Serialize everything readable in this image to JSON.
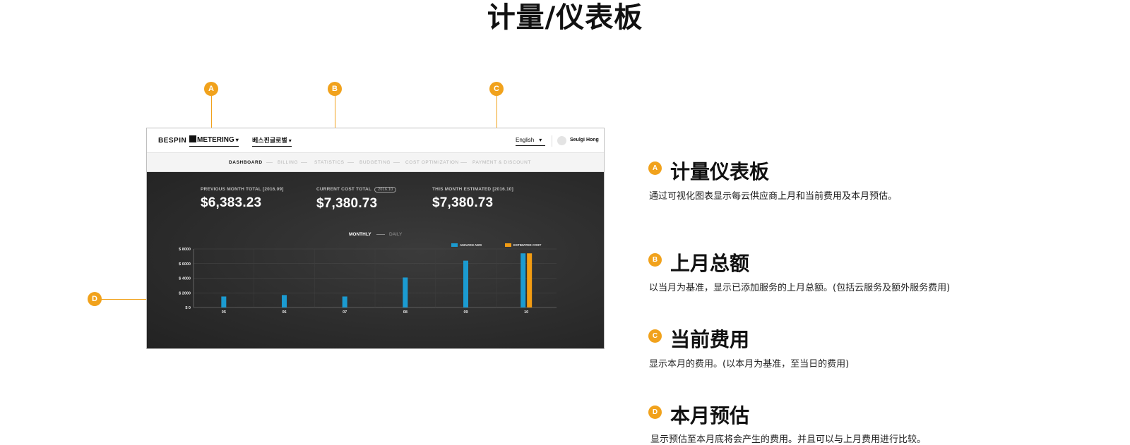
{
  "page": {
    "title": "计量/仪表板"
  },
  "callouts": [
    "A",
    "B",
    "C",
    "D"
  ],
  "app": {
    "logo": "BESPIN",
    "product": "METERING",
    "org": "베스핀글로벌",
    "language": "English",
    "user": "Seulgi Hong"
  },
  "nav": [
    "DASHBOARD",
    "BILLING",
    "STATISTICS",
    "BUDGETING",
    "COST OPTIMIZATION",
    "PAYMENT & DISCOUNT"
  ],
  "stats": {
    "previous": {
      "label": "PREVIOUS MONTH TOTAL [2016.09]",
      "value": "$6,383.23"
    },
    "current": {
      "label": "CURRENT COST TOTAL",
      "badge": "2016.10",
      "value": "$7,380.73"
    },
    "estimated": {
      "label": "THIS MONTH ESTIMATED [2016.10]",
      "value": "$7,380.73"
    }
  },
  "toggle": {
    "monthly": "MONTHLY",
    "daily": "DAILY"
  },
  "colors": {
    "accent": "#f1a21c",
    "aws": "#1b9bd1",
    "estimated": "#f39c12"
  },
  "chart_data": {
    "type": "bar",
    "categories": [
      "05",
      "06",
      "07",
      "08",
      "09",
      "10"
    ],
    "series": [
      {
        "name": "AMAZON AWS",
        "values": [
          1500,
          1700,
          1500,
          4100,
          6400,
          7400
        ]
      },
      {
        "name": "ESTIMATED COST",
        "values": [
          null,
          null,
          null,
          null,
          null,
          7400
        ]
      }
    ],
    "yticks": [
      "$ 0",
      "$ 2000",
      "$ 4000",
      "$ 6000",
      "$ 8000"
    ],
    "ylim": [
      0,
      8000
    ],
    "legend": "top-right",
    "grid": true
  },
  "descriptions": [
    {
      "marker": "A",
      "title": "计量仪表板",
      "text": "通过可视化图表显示每云供应商上月和当前费用及本月预估。"
    },
    {
      "marker": "B",
      "title": "上月总额",
      "text": "以当月为基准，显示已添加服务的上月总额。(包括云服务及额外服务费用)"
    },
    {
      "marker": "C",
      "title": "当前费用",
      "text": "显示本月的费用。(以本月为基准，至当日的费用)"
    },
    {
      "marker": "D",
      "title": "本月预估",
      "text": "显示预估至本月底将会产生的费用。并且可以与上月费用进行比较。"
    }
  ]
}
